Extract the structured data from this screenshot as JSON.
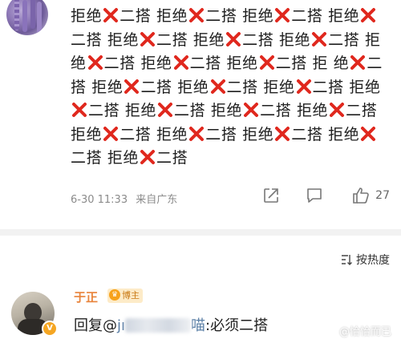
{
  "post": {
    "segments": [
      "拒绝",
      "二搭",
      "拒绝",
      "二搭",
      "拒绝",
      "二搭",
      "拒绝",
      "二搭",
      "拒绝",
      "二搭",
      "拒绝",
      "二搭",
      "拒绝",
      "二搭",
      "拒绝",
      "二搭",
      "拒绝",
      "二搭",
      "拒绝",
      "二搭",
      "拒",
      "绝",
      "二搭",
      "拒绝",
      "二搭",
      "拒绝",
      "二搭",
      "拒绝",
      "二搭",
      "拒绝",
      "二搭",
      "拒绝",
      "二搭",
      "拒绝",
      "二搭",
      "拒绝",
      "二搭",
      "拒绝",
      "二搭",
      "拒绝",
      "二搭",
      "拒绝",
      "二搭",
      "拒绝",
      "二搭",
      "拒绝",
      "二搭"
    ],
    "timestamp": "6-30 11:33",
    "source": "来自广东",
    "like_count": "27"
  },
  "sort": {
    "label": "按热度"
  },
  "reply": {
    "username": "于正",
    "badge_label": "博主",
    "prefix": "回复@",
    "mention_start": "jı",
    "mention_end": "喵",
    "colon_text": ":必须二搭"
  },
  "watermark": "@恰恰而已",
  "colors": {
    "x_mark": "#e0281e",
    "username": "#e8833a",
    "badge_bg": "#fdebc8",
    "divider": "#f2f2f2"
  },
  "icons": {
    "x_mark": "cross-mark-icon",
    "share": "share-icon",
    "comment": "comment-icon",
    "like": "thumbs-up-icon",
    "sort": "sort-icon"
  }
}
